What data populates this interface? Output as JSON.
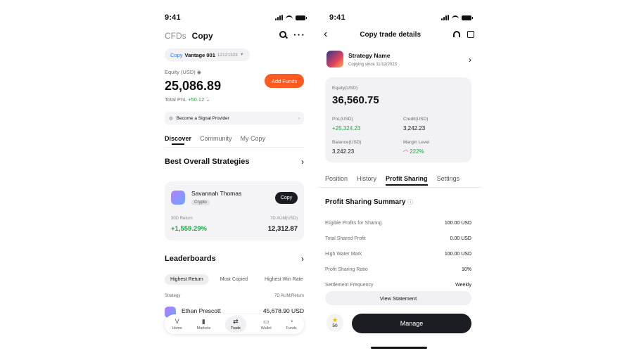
{
  "left": {
    "status_time": "9:41",
    "top_tabs": [
      "CFDs",
      "Copy"
    ],
    "account": {
      "prefix": "Copy",
      "name": "Vantage 001",
      "id": "12121323"
    },
    "equity_label": "Equity (USD)",
    "equity_value": "25,086.89",
    "total_pnl_label": "Total PnL",
    "total_pnl_value": "+50.12",
    "add_funds": "Add Funds",
    "signal_provider": "Become a Signal Provider",
    "sub_tabs": [
      "Discover",
      "Community",
      "My Copy"
    ],
    "best_title": "Best Overall Strategies",
    "card": {
      "name": "Savannah Thomas",
      "tag": "Crypto",
      "copy": "Copy",
      "return_label": "30D Return",
      "return_value": "+1,559.29%",
      "aum_label": "7D AUM(USD)",
      "aum_value": "12,312.87"
    },
    "leaderboards_title": "Leaderboards",
    "filters": [
      "Highest Return",
      "Most Copied",
      "Highest Win Rate"
    ],
    "table_headers": [
      "Strategy",
      "7D AUM/Return"
    ],
    "row": {
      "name": "Ethan Prescott",
      "value": "45,678.90 USD"
    },
    "nav": [
      "Home",
      "Markets",
      "Trade",
      "Wallet",
      "Funds"
    ]
  },
  "right": {
    "status_time": "9:41",
    "title": "Copy trade details",
    "strategy_name": "Strategy Name",
    "copying_since": "Copying since 11/12/2023",
    "equity_label": "Equity(USD)",
    "equity_value": "36,560.75",
    "pnl_label": "PnL(USD)",
    "pnl_value": "+25,324.23",
    "credit_label": "Credit(USD)",
    "credit_value": "3,242.23",
    "balance_label": "Balance(USD)",
    "balance_value": "3,242.23",
    "margin_label": "Margin Level",
    "margin_value": "222%",
    "tabs": [
      "Position",
      "History",
      "Profit Sharing",
      "Settings"
    ],
    "summary_title": "Profit Sharing Summary",
    "rows": [
      {
        "k": "Eligible Profits for Sharing",
        "v": "100.00 USD"
      },
      {
        "k": "Total Shared Profit",
        "v": "0.00 USD"
      },
      {
        "k": "High Water Mark",
        "v": "100.00 USD"
      },
      {
        "k": "Profit Sharing Ratio",
        "v": "10%"
      },
      {
        "k": "Settlement Frequency",
        "v": "Weekly"
      }
    ],
    "view_statement": "View Statement",
    "rating": "50",
    "manage": "Manage"
  }
}
